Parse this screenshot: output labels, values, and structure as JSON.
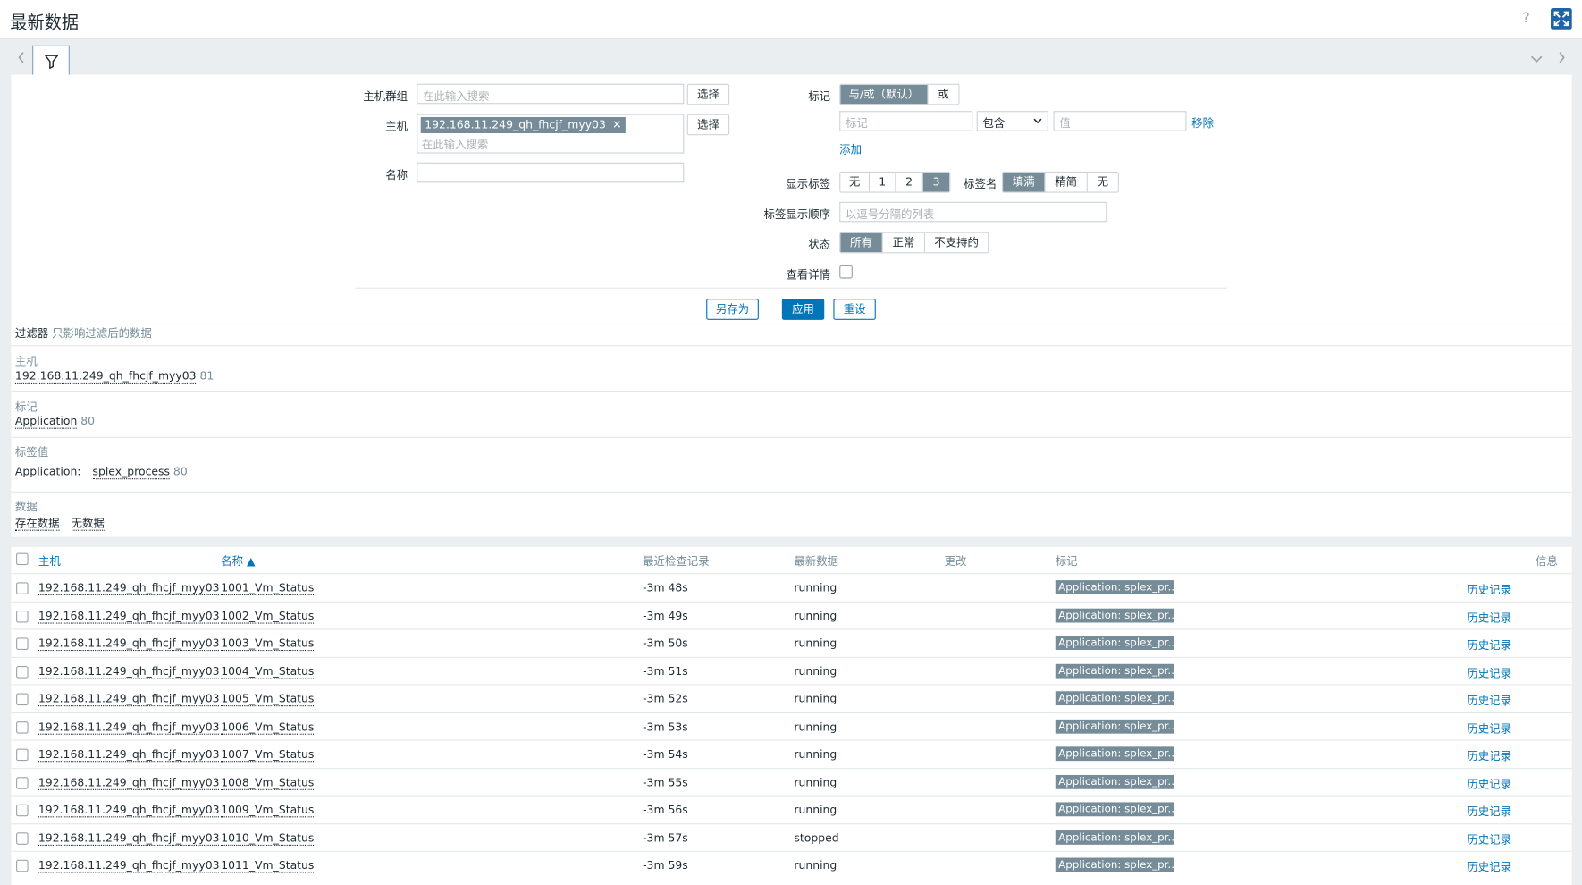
{
  "page": {
    "title": "最新数据",
    "help": "?"
  },
  "filter": {
    "host_groups_label": "主机群组",
    "host_groups_placeholder": "在此输入搜索",
    "select_label": "选择",
    "hosts_label": "主机",
    "hosts_chip": "192.168.11.249_qh_fhcjf_myy03",
    "chip_remove": "✕",
    "hosts_placeholder": "在此输入搜索",
    "name_label": "名称",
    "name_value": "",
    "tags_label": "标记",
    "tags_mode": [
      "与/或（默认）",
      "或"
    ],
    "tag_placeholder": "标记",
    "tag_operator": "包含",
    "value_placeholder": "值",
    "remove_label": "移除",
    "add_label": "添加",
    "show_tags_label": "显示标签",
    "show_tags_options": [
      "无",
      "1",
      "2",
      "3"
    ],
    "tag_name_label": "标签名",
    "tag_name_options": [
      "填满",
      "精简",
      "无"
    ],
    "tag_priority_label": "标签显示顺序",
    "tag_priority_placeholder": "以逗号分隔的列表",
    "state_label": "状态",
    "state_options": [
      "所有",
      "正常",
      "不支持的"
    ],
    "show_details_label": "查看详情",
    "save_as": "另存为",
    "apply": "应用",
    "reset": "重设"
  },
  "subfilter": {
    "title": "过滤器",
    "hint": "只影响过滤后的数据",
    "hosts_head": "主机",
    "hosts_value": "192.168.11.249_qh_fhcjf_myy03",
    "hosts_count": "81",
    "tags_head": "标记",
    "tags_value": "Application",
    "tags_count": "80",
    "tagvalues_head": "标签值",
    "tagvalues_key": "Application:",
    "tagvalues_value": "splex_process",
    "tagvalues_count": "80",
    "data_head": "数据",
    "data_with": "存在数据",
    "data_without": "无数据"
  },
  "table": {
    "headers": {
      "host": "主机",
      "name": "名称 ▲",
      "last_check": "最近检查记录",
      "last_value": "最新数据",
      "change": "更改",
      "tags": "标记",
      "info": "信息"
    },
    "rows": [
      {
        "host": "192.168.11.249_qh_fhcjf_myy03",
        "name": "1001_Vm_Status",
        "last_check": "-3m 48s",
        "last_value": "running",
        "tag": "Application: splex_pr...",
        "link": "历史记录"
      },
      {
        "host": "192.168.11.249_qh_fhcjf_myy03",
        "name": "1002_Vm_Status",
        "last_check": "-3m 49s",
        "last_value": "running",
        "tag": "Application: splex_pr...",
        "link": "历史记录"
      },
      {
        "host": "192.168.11.249_qh_fhcjf_myy03",
        "name": "1003_Vm_Status",
        "last_check": "-3m 50s",
        "last_value": "running",
        "tag": "Application: splex_pr...",
        "link": "历史记录"
      },
      {
        "host": "192.168.11.249_qh_fhcjf_myy03",
        "name": "1004_Vm_Status",
        "last_check": "-3m 51s",
        "last_value": "running",
        "tag": "Application: splex_pr...",
        "link": "历史记录"
      },
      {
        "host": "192.168.11.249_qh_fhcjf_myy03",
        "name": "1005_Vm_Status",
        "last_check": "-3m 52s",
        "last_value": "running",
        "tag": "Application: splex_pr...",
        "link": "历史记录"
      },
      {
        "host": "192.168.11.249_qh_fhcjf_myy03",
        "name": "1006_Vm_Status",
        "last_check": "-3m 53s",
        "last_value": "running",
        "tag": "Application: splex_pr...",
        "link": "历史记录"
      },
      {
        "host": "192.168.11.249_qh_fhcjf_myy03",
        "name": "1007_Vm_Status",
        "last_check": "-3m 54s",
        "last_value": "running",
        "tag": "Application: splex_pr...",
        "link": "历史记录"
      },
      {
        "host": "192.168.11.249_qh_fhcjf_myy03",
        "name": "1008_Vm_Status",
        "last_check": "-3m 55s",
        "last_value": "running",
        "tag": "Application: splex_pr...",
        "link": "历史记录"
      },
      {
        "host": "192.168.11.249_qh_fhcjf_myy03",
        "name": "1009_Vm_Status",
        "last_check": "-3m 56s",
        "last_value": "running",
        "tag": "Application: splex_pr...",
        "link": "历史记录"
      },
      {
        "host": "192.168.11.249_qh_fhcjf_myy03",
        "name": "1010_Vm_Status",
        "last_check": "-3m 57s",
        "last_value": "stopped",
        "tag": "Application: splex_pr...",
        "link": "历史记录"
      },
      {
        "host": "192.168.11.249_qh_fhcjf_myy03",
        "name": "1011_Vm_Status",
        "last_check": "-3m 59s",
        "last_value": "running",
        "tag": "Application: splex_pr...",
        "link": "历史记录"
      }
    ]
  }
}
